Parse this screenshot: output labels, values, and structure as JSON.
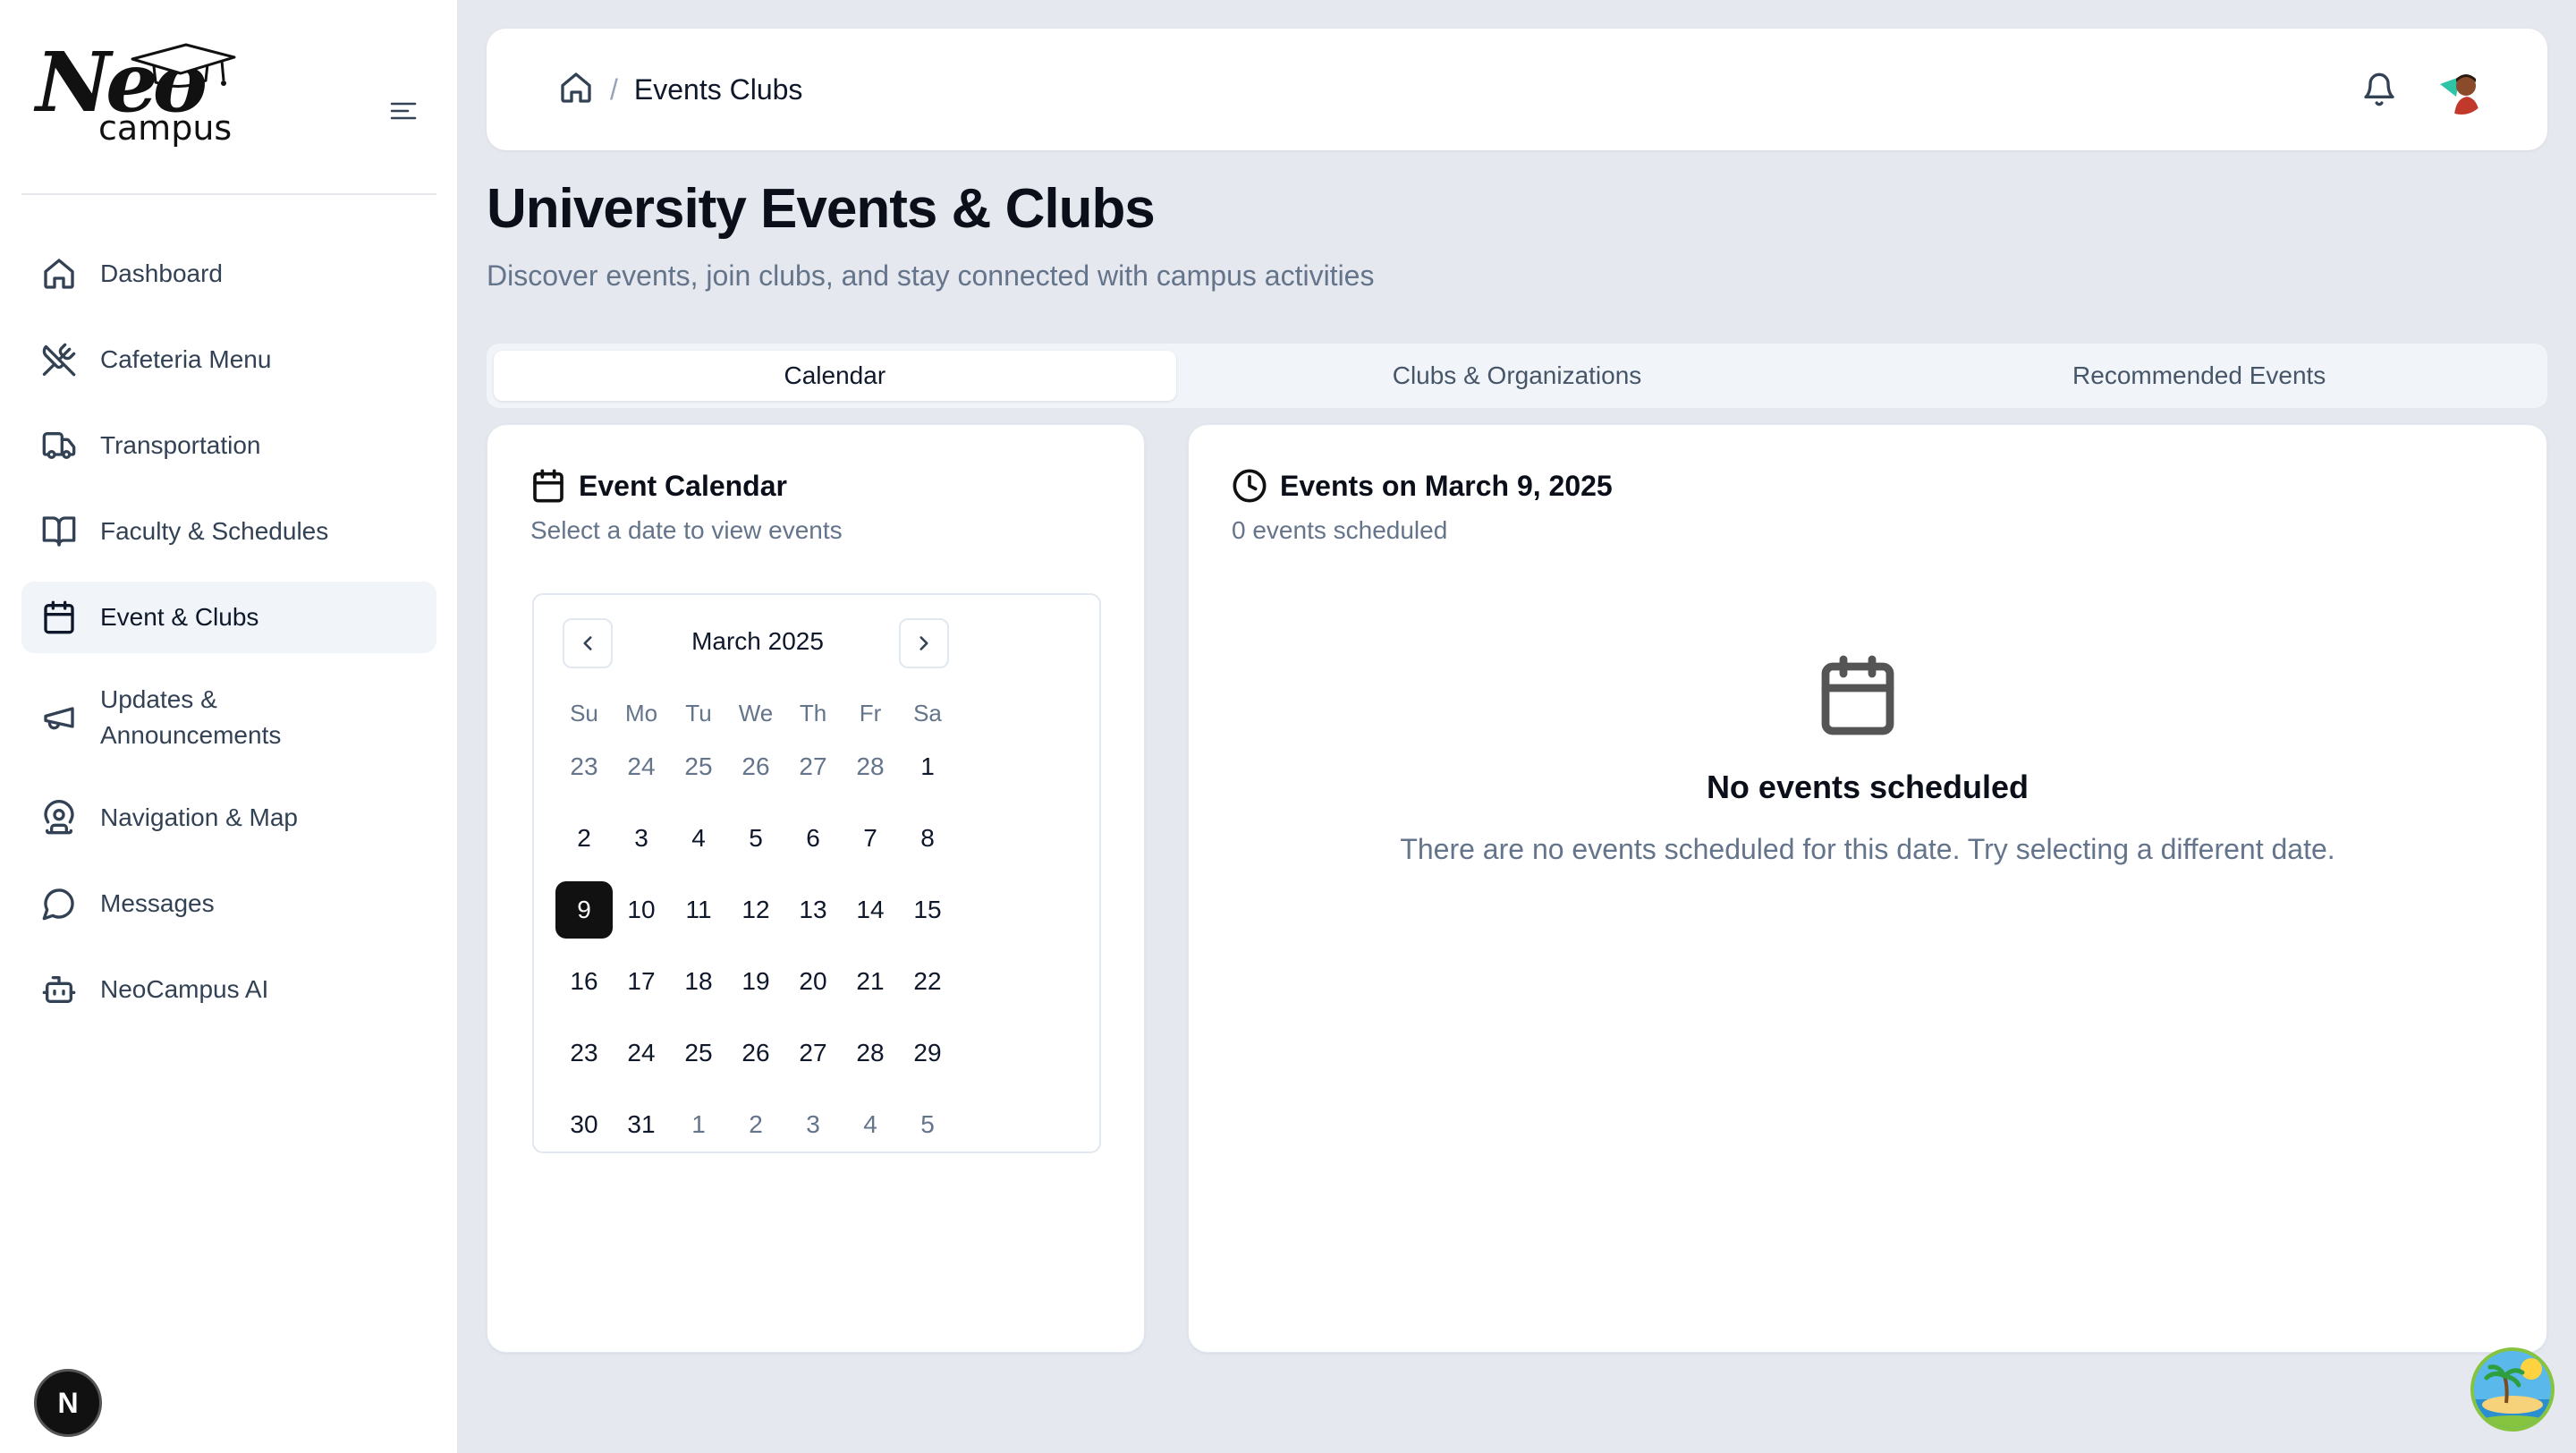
{
  "brand": {
    "name_top": "Neo",
    "name_bottom": "campus"
  },
  "sidebar": {
    "items": [
      {
        "label": "Dashboard",
        "icon": "home-icon"
      },
      {
        "label": "Cafeteria Menu",
        "icon": "utensils-crossed-icon"
      },
      {
        "label": "Transportation",
        "icon": "truck-icon"
      },
      {
        "label": "Faculty & Schedules",
        "icon": "book-open-icon"
      },
      {
        "label": "Event & Clubs",
        "icon": "calendar-icon",
        "active": true
      },
      {
        "label": "Updates & Announcements",
        "icon": "megaphone-icon"
      },
      {
        "label": "Navigation & Map",
        "icon": "map-pin-user-icon"
      },
      {
        "label": "Messages",
        "icon": "message-circle-icon"
      },
      {
        "label": "NeoCampus AI",
        "icon": "bot-icon"
      }
    ],
    "dev_badge": "N"
  },
  "header": {
    "breadcrumb_current": "Events Clubs",
    "separator": "/"
  },
  "page": {
    "title": "University Events & Clubs",
    "subtitle": "Discover events, join clubs, and stay connected with campus activities"
  },
  "tabs": [
    {
      "label": "Calendar",
      "active": true
    },
    {
      "label": "Clubs & Organizations",
      "active": false
    },
    {
      "label": "Recommended Events",
      "active": false
    }
  ],
  "calendar_card": {
    "title": "Event Calendar",
    "description": "Select a date to view events",
    "month_label": "March 2025",
    "weekdays": [
      "Su",
      "Mo",
      "Tu",
      "We",
      "Th",
      "Fr",
      "Sa"
    ],
    "days": [
      {
        "d": "23",
        "out": true
      },
      {
        "d": "24",
        "out": true
      },
      {
        "d": "25",
        "out": true
      },
      {
        "d": "26",
        "out": true
      },
      {
        "d": "27",
        "out": true
      },
      {
        "d": "28",
        "out": true
      },
      {
        "d": "1"
      },
      {
        "d": "2"
      },
      {
        "d": "3"
      },
      {
        "d": "4"
      },
      {
        "d": "5"
      },
      {
        "d": "6"
      },
      {
        "d": "7"
      },
      {
        "d": "8"
      },
      {
        "d": "9",
        "selected": true
      },
      {
        "d": "10"
      },
      {
        "d": "11"
      },
      {
        "d": "12"
      },
      {
        "d": "13"
      },
      {
        "d": "14"
      },
      {
        "d": "15"
      },
      {
        "d": "16"
      },
      {
        "d": "17"
      },
      {
        "d": "18"
      },
      {
        "d": "19"
      },
      {
        "d": "20"
      },
      {
        "d": "21"
      },
      {
        "d": "22"
      },
      {
        "d": "23"
      },
      {
        "d": "24"
      },
      {
        "d": "25"
      },
      {
        "d": "26"
      },
      {
        "d": "27"
      },
      {
        "d": "28"
      },
      {
        "d": "29"
      },
      {
        "d": "30"
      },
      {
        "d": "31"
      },
      {
        "d": "1",
        "out": true
      },
      {
        "d": "2",
        "out": true
      },
      {
        "d": "3",
        "out": true
      },
      {
        "d": "4",
        "out": true
      },
      {
        "d": "5",
        "out": true
      }
    ]
  },
  "events_card": {
    "title": "Events on March 9, 2025",
    "count_text": "0 events scheduled",
    "empty_title": "No events scheduled",
    "empty_description": "There are no events scheduled for this date. Try selecting a different date."
  },
  "colors": {
    "background": "#e5e8ee",
    "selected_day": "#111111",
    "muted_text": "#64748b"
  }
}
